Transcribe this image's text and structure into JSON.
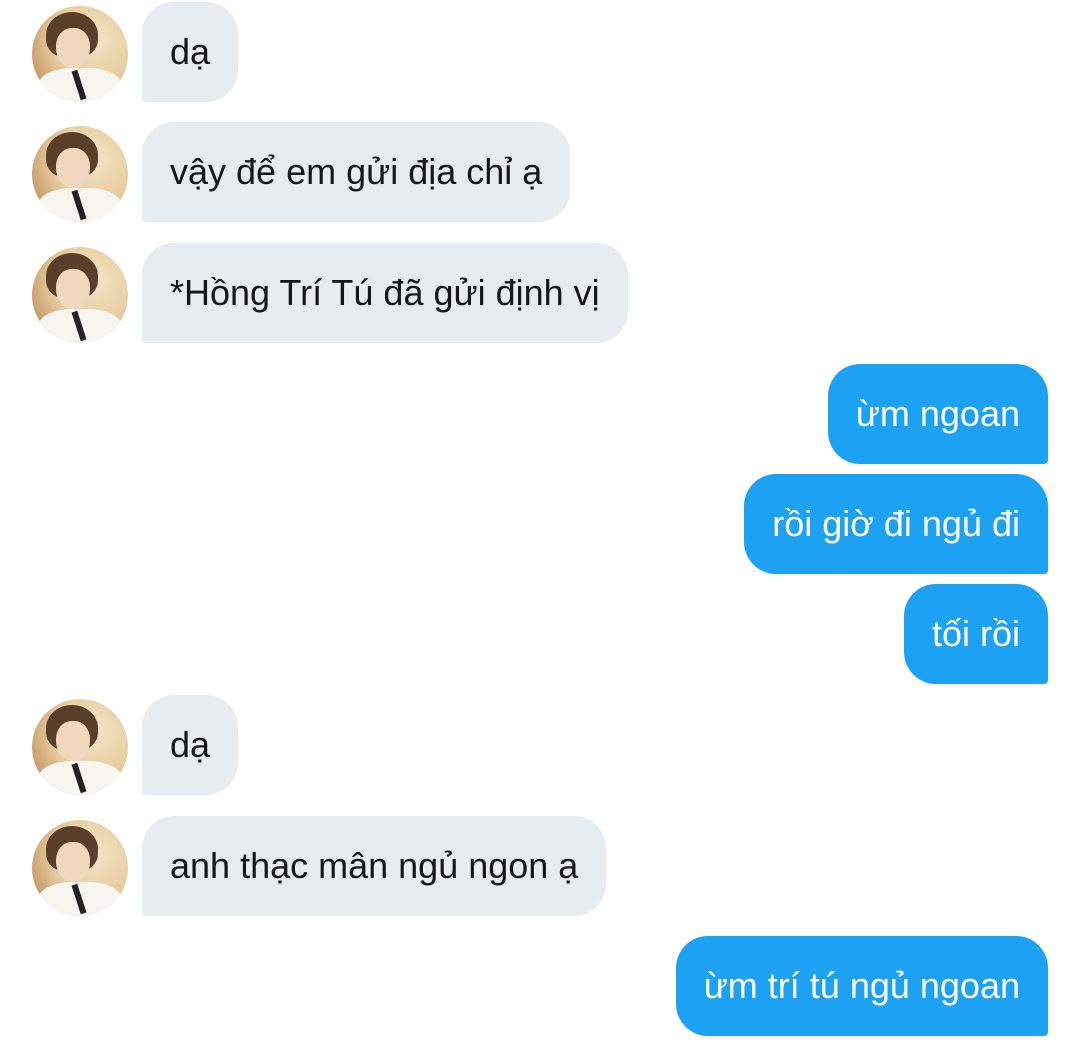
{
  "colors": {
    "incoming_bubble": "#e6ecf0",
    "incoming_text": "#14171a",
    "outgoing_bubble": "#1da1f2",
    "outgoing_text": "#ffffff",
    "background": "#ffffff"
  },
  "messages": [
    {
      "direction": "incoming",
      "text": "dạ"
    },
    {
      "direction": "incoming",
      "text": "vậy để em gửi địa chỉ ạ"
    },
    {
      "direction": "incoming",
      "text": "*Hồng Trí Tú đã gửi định vị"
    },
    {
      "direction": "outgoing",
      "text": "ừm ngoan"
    },
    {
      "direction": "outgoing",
      "text": "rồi giờ đi ngủ đi"
    },
    {
      "direction": "outgoing",
      "text": "tối rồi"
    },
    {
      "direction": "incoming",
      "text": "dạ"
    },
    {
      "direction": "incoming",
      "text": "anh thạc mân ngủ ngon ạ"
    },
    {
      "direction": "outgoing",
      "text": "ừm trí tú ngủ ngoan"
    }
  ]
}
